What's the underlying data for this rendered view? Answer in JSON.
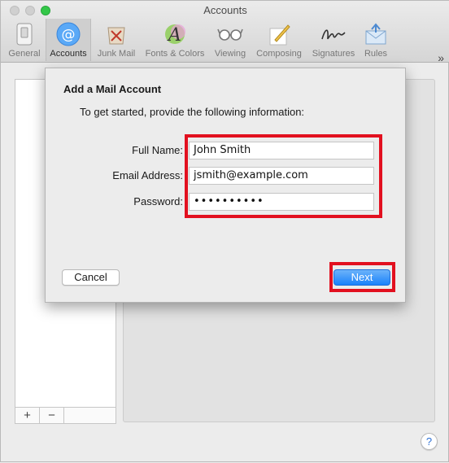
{
  "window": {
    "title": "Accounts"
  },
  "toolbar": {
    "items": [
      {
        "label": "General",
        "icon": "general-switch-icon"
      },
      {
        "label": "Accounts",
        "icon": "at-sign-icon"
      },
      {
        "label": "Junk Mail",
        "icon": "junk-mail-icon"
      },
      {
        "label": "Fonts & Colors",
        "icon": "fonts-colors-icon"
      },
      {
        "label": "Viewing",
        "icon": "glasses-icon"
      },
      {
        "label": "Composing",
        "icon": "pencil-paper-icon"
      },
      {
        "label": "Signatures",
        "icon": "signature-icon"
      },
      {
        "label": "Rules",
        "icon": "rules-envelope-icon"
      }
    ],
    "overflow": "»"
  },
  "list_buttons": {
    "add": "+",
    "remove": "−"
  },
  "help": {
    "label": "?"
  },
  "sheet": {
    "title": "Add a Mail Account",
    "subtitle": "To get started, provide the following information:",
    "fields": {
      "full_name": {
        "label": "Full Name:",
        "value": "John Smith"
      },
      "email": {
        "label": "Email Address:",
        "value": "jsmith@example.com"
      },
      "password": {
        "label": "Password:",
        "value": "••••••••••"
      }
    },
    "cancel_label": "Cancel",
    "next_label": "Next"
  },
  "colors": {
    "accent": "#1a82fb",
    "highlight": "#e2101f"
  }
}
